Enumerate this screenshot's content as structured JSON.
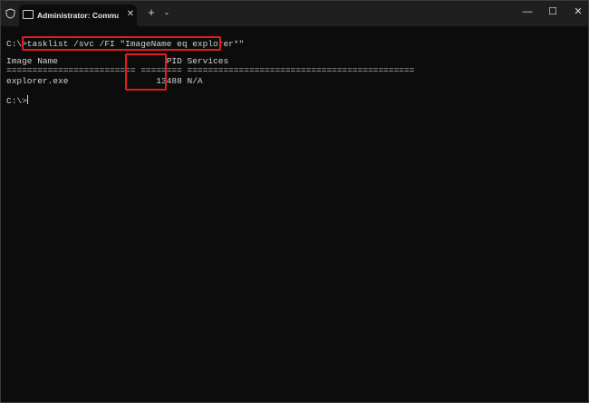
{
  "window": {
    "tab_title": "Administrator: Command Pro",
    "tab_close": "✕",
    "new_tab": "+",
    "dropdown": "⌄",
    "min": "—",
    "max": "☐",
    "close": "✕"
  },
  "console": {
    "line1": "C:\\>tasklist /svc /FI \"ImageName eq explorer*\"",
    "line2": "Image Name                     PID Services",
    "line3": "========================= ======== ============================================",
    "line4": "explorer.exe                 13488 N/A",
    "line5": "C:\\>"
  },
  "colors": {
    "background": "#0c0c0c",
    "titlebar": "#1f1f1f",
    "text": "#d3d3d3",
    "highlight": "#e31b23"
  }
}
